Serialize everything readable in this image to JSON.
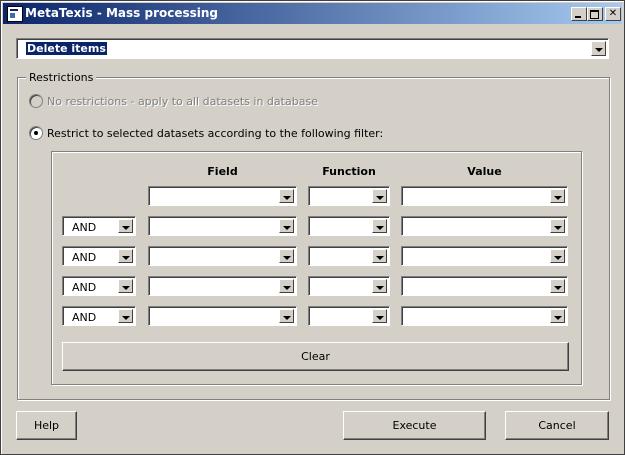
{
  "window": {
    "title": "MetaTexis - Mass processing"
  },
  "operation": {
    "selected": "Delete items"
  },
  "restrictions": {
    "group_label": "Restrictions",
    "option_none": "No restrictions - apply to all datasets in database",
    "option_filter": "Restrict to selected datasets according to the following filter:"
  },
  "filter": {
    "headers": {
      "field": "Field",
      "function": "Function",
      "value": "Value"
    },
    "rows": [
      {
        "connector": "",
        "field": "",
        "function": "",
        "value": ""
      },
      {
        "connector": "AND",
        "field": "",
        "function": "",
        "value": ""
      },
      {
        "connector": "AND",
        "field": "",
        "function": "",
        "value": ""
      },
      {
        "connector": "AND",
        "field": "",
        "function": "",
        "value": ""
      },
      {
        "connector": "AND",
        "field": "",
        "function": "",
        "value": ""
      }
    ],
    "clear_label": "Clear"
  },
  "buttons": {
    "help": "Help",
    "execute": "Execute",
    "cancel": "Cancel"
  }
}
